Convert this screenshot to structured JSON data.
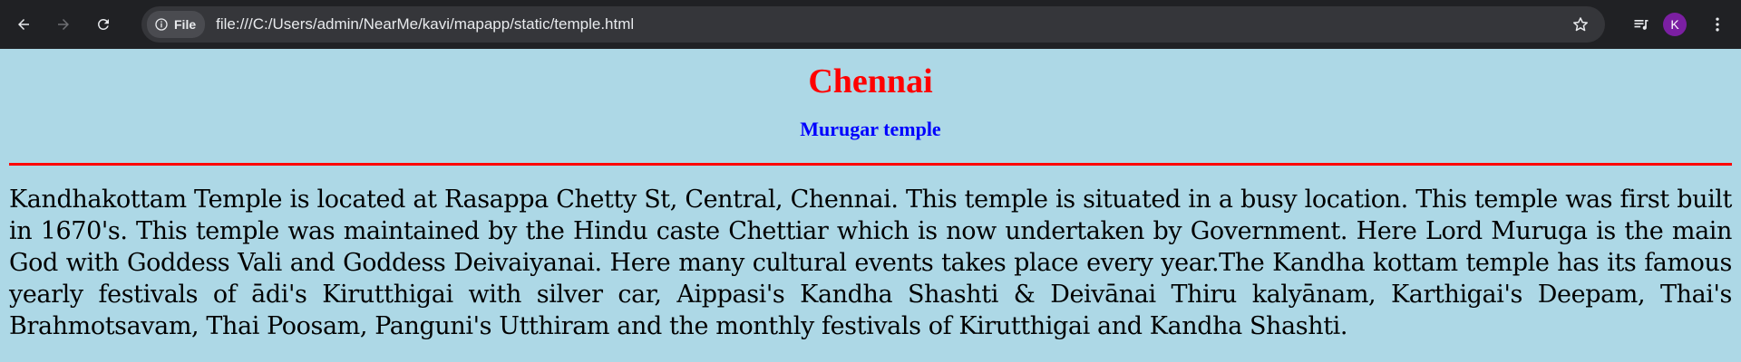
{
  "browser": {
    "site_chip_label": "File",
    "url": "file:///C:/Users/admin/NearMe/kavi/mapapp/static/temple.html",
    "avatar_letter": "K",
    "avatar_color": "#7b1fa2"
  },
  "page": {
    "title": "Chennai",
    "subtitle": "Murugar temple",
    "description": "Kandhakottam Temple is located at Rasappa Chetty St, Central, Chennai. This temple is situated in a busy location. This temple was first built in 1670's. This temple was maintained by the Hindu caste Chettiar which is now undertaken by Government. Here Lord Muruga is the main God with Goddess Vali and Goddess Deivaiyanai. Here many cultural events takes place every year.The Kandha kottam temple has its famous yearly festivals of ādi's Kirutthigai with silver car, Aippasi's Kandha Shashti & Deivānai Thiru kalyānam, Karthigai's Deepam, Thai's Brahmotsavam, Thai Poosam, Panguni's Utthiram and the monthly festivals of Kirutthigai and Kandha Shashti."
  },
  "colors": {
    "background": "#add8e6",
    "title": "#ff0000",
    "subtitle": "#0000ff",
    "divider": "#ff0000"
  },
  "icons": {
    "back": "arrow-left-icon",
    "forward": "arrow-right-icon",
    "reload": "reload-icon",
    "info": "info-icon",
    "bookmark": "star-icon",
    "media": "playlist-icon",
    "menu": "kebab-menu-icon"
  }
}
